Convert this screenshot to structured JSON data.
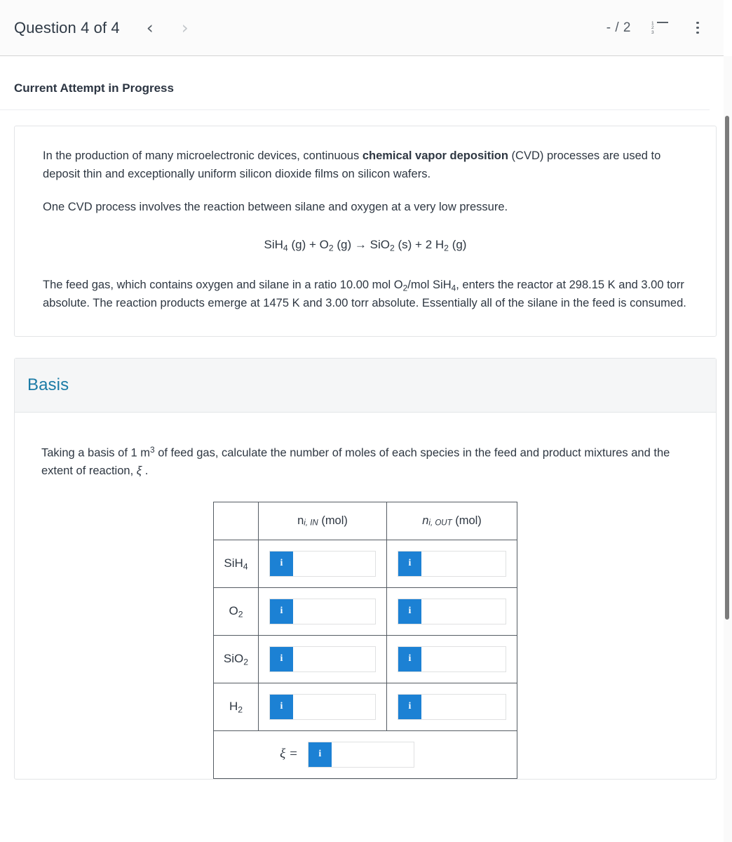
{
  "header": {
    "question_title": "Question 4 of 4",
    "prev_label": "‹",
    "next_label": "›",
    "score": "- / 2",
    "list_icon_digits": [
      "1",
      "2",
      "3"
    ]
  },
  "attempt": {
    "title": "Current Attempt in Progress"
  },
  "question": {
    "para1_before_bold": "In the production of many microelectronic devices, continuous ",
    "para1_bold": "chemical vapor deposition",
    "para1_after_bold": " (CVD) processes are used to deposit thin and exceptionally uniform silicon dioxide films on silicon wafers.",
    "para2": "One CVD process involves the reaction between silane and oxygen at a very low pressure.",
    "equation": {
      "reactant1": "SiH",
      "reactant1_sub": "4",
      "reactant1_state": " (g)",
      "plus1": " + ",
      "reactant2": "O",
      "reactant2_sub": "2",
      "reactant2_state": " (g)",
      "arrow": " → ",
      "product1": "SiO",
      "product1_sub": "2",
      "product1_state": " (s)",
      "plus2": " + ",
      "product2_coeff": "2 ",
      "product2": "H",
      "product2_sub": "2",
      "product2_state": " (g)"
    },
    "para3_a": "The feed gas, which contains oxygen and silane in a ratio 10.00 mol O",
    "para3_sub1": "2",
    "para3_b": "/mol SiH",
    "para3_sub2": "4",
    "para3_c": ", enters the reactor at 298.15 K and 3.00 torr absolute. The reaction products emerge at 1475 K and 3.00 torr absolute. Essentially all of the silane in the feed is consumed."
  },
  "basis": {
    "heading": "Basis",
    "instruction_a": "Taking a basis of 1 m",
    "instruction_sup": "3",
    "instruction_b": " of feed gas, calculate the number of moles of each species in the feed and product mixtures and the extent of reaction, ",
    "instruction_xi": "ξ",
    "instruction_c": " ."
  },
  "table": {
    "corner_header": "",
    "header_in_n": "n",
    "header_in_sub": "i, IN",
    "header_in_unit": " (mol)",
    "header_out_n": "n",
    "header_out_sub": "i, OUT",
    "header_out_unit": " (mol)",
    "rows": [
      {
        "species": "SiH",
        "species_sub": "4",
        "in_value": "",
        "out_value": ""
      },
      {
        "species": "O",
        "species_sub": "2",
        "in_value": "",
        "out_value": ""
      },
      {
        "species": "SiO",
        "species_sub": "2",
        "in_value": "",
        "out_value": ""
      },
      {
        "species": "H",
        "species_sub": "2",
        "in_value": "",
        "out_value": ""
      }
    ],
    "info_button_label": "i",
    "xi_label": "ξ =",
    "xi_value": ""
  },
  "colors": {
    "accent_blue": "#1c81d4",
    "heading_blue": "#1b7ba6",
    "text": "#2e3742",
    "table_border": "#555c63",
    "section_head_bg": "#f5f6f7"
  }
}
